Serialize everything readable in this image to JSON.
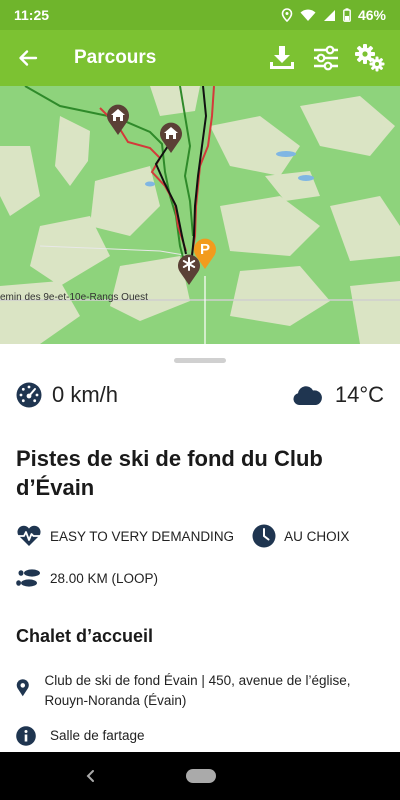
{
  "status_bar": {
    "time": "11:25",
    "battery": "46%"
  },
  "app_bar": {
    "title": "Parcours",
    "icons": [
      "arrow-left",
      "download",
      "sliders",
      "gears"
    ]
  },
  "map": {
    "road_label": "emin des 9e-et-10e-Rangs Ouest",
    "markers": [
      "chalet",
      "chalet",
      "trail-start",
      "parking"
    ],
    "parking_letter": "P"
  },
  "weather": {
    "speed": "0 km/h",
    "temperature": "14°C",
    "condition_icon": "cloud"
  },
  "trail": {
    "title": "Pistes de ski de fond du Club d’Évain",
    "difficulty": "EASY TO VERY DEMANDING",
    "duration": "AU CHOIX",
    "distance": "28.00 KM (LOOP)"
  },
  "section": {
    "title": "Chalet d’accueil",
    "address": "Club de ski de fond Évain | 450, avenue de l’église, Rouyn-Noranda (Évain)",
    "service": "Salle de fartage"
  },
  "colors": {
    "status_bar": "#6fb52c",
    "app_bar": "#7cc232",
    "map_green": "#8ed37c",
    "icon_navy": "#1f3550",
    "marker_brown": "#5b4036",
    "parking_orange": "#f29b1d"
  }
}
